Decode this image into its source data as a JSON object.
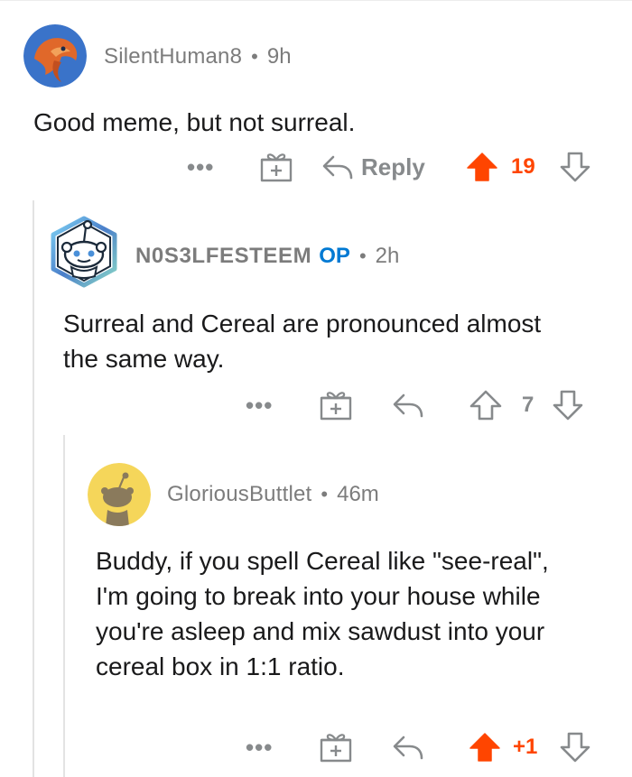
{
  "comments": [
    {
      "username": "SilentHuman8",
      "separator": "•",
      "time": "9h",
      "body": "Good meme, but not surreal.",
      "more": "•••",
      "reply_label": "Reply",
      "score": "19",
      "upvoted": true
    },
    {
      "username": "N0S3LFESTEEM",
      "op_badge": "OP",
      "separator": "•",
      "time": "2h",
      "body": "Surreal and Cereal are pronounced almost the same way.",
      "more": "•••",
      "score": "7",
      "upvoted": false
    },
    {
      "username": "GloriousButtlet",
      "separator": "•",
      "time": "46m",
      "body": "Buddy, if you spell Cereal like \"see-real\", I'm going to break into your house while you're asleep and mix sawdust into your cereal box in 1:1 ratio.",
      "more": "•••",
      "score": "+1",
      "upvoted": true
    }
  ],
  "colors": {
    "upvote": "#ff4500",
    "meta": "#7c7c7c",
    "icon": "#878a8c",
    "op": "#0079d3",
    "thread_line": "#e3e3e3"
  },
  "icons": [
    "award-icon",
    "reply-arrow-icon",
    "upvote-arrow-icon",
    "downvote-arrow-icon",
    "more-options-icon"
  ]
}
